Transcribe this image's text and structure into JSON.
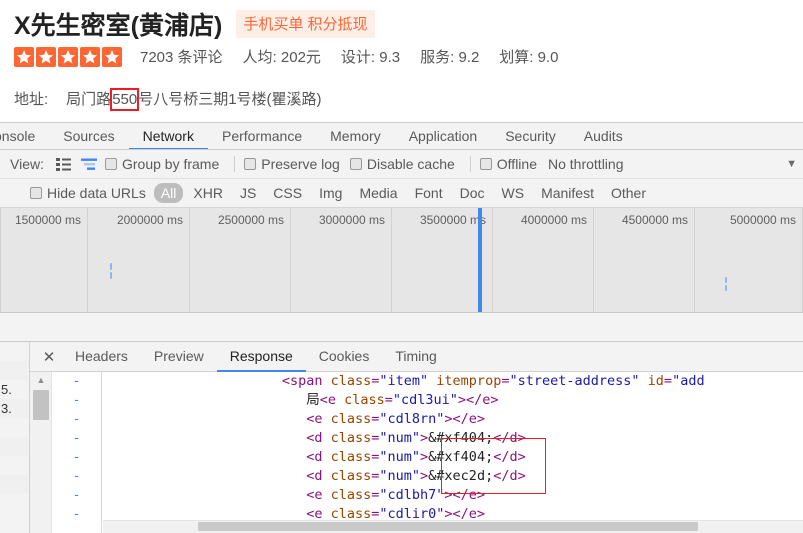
{
  "shop": {
    "name": "X先生密室(黄浦店)",
    "badge": "手机买单 积分抵现",
    "star_count": 5,
    "reviews": "7203 条评论",
    "avg_price": "人均: 202元",
    "score_design": "设计: 9.3",
    "score_service": "服务: 9.2",
    "score_value": "划算: 9.0",
    "address_label": "地址:",
    "address_pre": "局门路",
    "address_highlight": "550",
    "address_post": "号八号桥三期1号楼(瞿溪路)",
    "accent_color": "#ff6633",
    "badge_bg": "#fdeee7",
    "annotation_color": "#ee1c25"
  },
  "devtools": {
    "tabs": [
      {
        "label": "onsole",
        "active": false
      },
      {
        "label": "Sources",
        "active": false
      },
      {
        "label": "Network",
        "active": true
      },
      {
        "label": "Performance",
        "active": false
      },
      {
        "label": "Memory",
        "active": false
      },
      {
        "label": "Application",
        "active": false
      },
      {
        "label": "Security",
        "active": false
      },
      {
        "label": "Audits",
        "active": false
      }
    ],
    "toolbar": {
      "view_label": "View:",
      "list_view_icon": "list-view-icon",
      "waterfall_view_icon": "waterfall-view-icon",
      "group_by_frame": "Group by frame",
      "preserve_log": "Preserve log",
      "disable_cache": "Disable cache",
      "offline": "Offline",
      "throttling": "No throttling",
      "overflow_icon": "chevron-down-icon"
    },
    "filters": {
      "hide_data_urls": "Hide data URLs",
      "types": [
        {
          "label": "All",
          "active": true
        },
        {
          "label": "XHR",
          "active": false
        },
        {
          "label": "JS",
          "active": false
        },
        {
          "label": "CSS",
          "active": false
        },
        {
          "label": "Img",
          "active": false
        },
        {
          "label": "Media",
          "active": false
        },
        {
          "label": "Font",
          "active": false
        },
        {
          "label": "Doc",
          "active": false
        },
        {
          "label": "WS",
          "active": false
        },
        {
          "label": "Manifest",
          "active": false
        },
        {
          "label": "Other",
          "active": false
        }
      ]
    },
    "timeline": {
      "ticks": [
        "1500000 ms",
        "2000000 ms",
        "2500000 ms",
        "3000000 ms",
        "3500000 ms",
        "4000000 ms",
        "4500000 ms",
        "5000000 ms"
      ],
      "playhead_color": "#4285f4",
      "event_bar_color": "#8ab8f0"
    },
    "request_list_rows": [
      "",
      "",
      "5.",
      "3.",
      "",
      "",
      "",
      ""
    ],
    "subtabs": [
      {
        "label": "Headers",
        "active": false
      },
      {
        "label": "Preview",
        "active": false
      },
      {
        "label": "Response",
        "active": true
      },
      {
        "label": "Cookies",
        "active": false
      },
      {
        "label": "Timing",
        "active": false
      }
    ],
    "close_icon": "close-icon",
    "code": {
      "fold_marker": "-",
      "lines": [
        [
          {
            "t": "punct",
            "s": "<"
          },
          {
            "t": "tag",
            "s": "span "
          },
          {
            "t": "attr",
            "s": "class"
          },
          {
            "t": "punct",
            "s": "="
          },
          {
            "t": "val",
            "s": "\"item\""
          },
          {
            "t": "text",
            "s": " "
          },
          {
            "t": "attr",
            "s": "itemprop"
          },
          {
            "t": "punct",
            "s": "="
          },
          {
            "t": "val",
            "s": "\"street-address\""
          },
          {
            "t": "text",
            "s": " "
          },
          {
            "t": "attr",
            "s": "id"
          },
          {
            "t": "punct",
            "s": "="
          },
          {
            "t": "val",
            "s": "\"add"
          }
        ],
        [
          {
            "t": "text",
            "s": "局"
          },
          {
            "t": "punct",
            "s": "<"
          },
          {
            "t": "tag",
            "s": "e "
          },
          {
            "t": "attr",
            "s": "class"
          },
          {
            "t": "punct",
            "s": "="
          },
          {
            "t": "val",
            "s": "\"cdl3ui\""
          },
          {
            "t": "punct",
            "s": "></e>"
          }
        ],
        [
          {
            "t": "punct",
            "s": "<"
          },
          {
            "t": "tag",
            "s": "e "
          },
          {
            "t": "attr",
            "s": "class"
          },
          {
            "t": "punct",
            "s": "="
          },
          {
            "t": "val",
            "s": "\"cdl8rn\""
          },
          {
            "t": "punct",
            "s": "></e>"
          }
        ],
        [
          {
            "t": "punct",
            "s": "<"
          },
          {
            "t": "tag",
            "s": "d "
          },
          {
            "t": "attr",
            "s": "class"
          },
          {
            "t": "punct",
            "s": "="
          },
          {
            "t": "val",
            "s": "\"num\""
          },
          {
            "t": "punct",
            "s": ">"
          },
          {
            "t": "text",
            "s": "&#xf404;"
          },
          {
            "t": "punct",
            "s": "</d>"
          }
        ],
        [
          {
            "t": "punct",
            "s": "<"
          },
          {
            "t": "tag",
            "s": "d "
          },
          {
            "t": "attr",
            "s": "class"
          },
          {
            "t": "punct",
            "s": "="
          },
          {
            "t": "val",
            "s": "\"num\""
          },
          {
            "t": "punct",
            "s": ">"
          },
          {
            "t": "text",
            "s": "&#xf404;"
          },
          {
            "t": "punct",
            "s": "</d>"
          }
        ],
        [
          {
            "t": "punct",
            "s": "<"
          },
          {
            "t": "tag",
            "s": "d "
          },
          {
            "t": "attr",
            "s": "class"
          },
          {
            "t": "punct",
            "s": "="
          },
          {
            "t": "val",
            "s": "\"num\""
          },
          {
            "t": "punct",
            "s": ">"
          },
          {
            "t": "text",
            "s": "&#xec2d;"
          },
          {
            "t": "punct",
            "s": "</d>"
          }
        ],
        [
          {
            "t": "punct",
            "s": "<"
          },
          {
            "t": "tag",
            "s": "e "
          },
          {
            "t": "attr",
            "s": "class"
          },
          {
            "t": "punct",
            "s": "="
          },
          {
            "t": "val",
            "s": "\"cdlbh7\""
          },
          {
            "t": "punct",
            "s": "></e>"
          }
        ],
        [
          {
            "t": "punct",
            "s": "<"
          },
          {
            "t": "tag",
            "s": "e "
          },
          {
            "t": "attr",
            "s": "class"
          },
          {
            "t": "punct",
            "s": "="
          },
          {
            "t": "val",
            "s": "\"cdlir0\""
          },
          {
            "t": "punct",
            "s": "></e>"
          }
        ]
      ]
    }
  }
}
